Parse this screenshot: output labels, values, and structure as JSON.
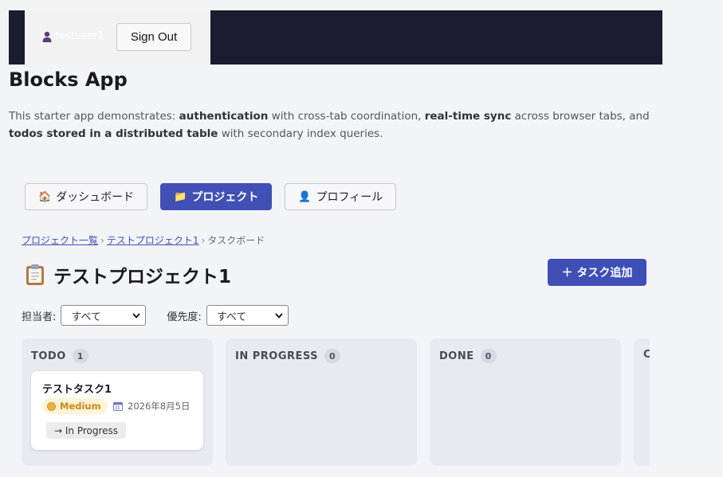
{
  "header": {
    "username": "testuser1",
    "sign_out_label": "Sign Out"
  },
  "app": {
    "title": "Blocks App",
    "description": [
      {
        "text": "This starter app demonstrates: ",
        "bold": false
      },
      {
        "text": "authentication",
        "bold": true
      },
      {
        "text": " with cross-tab coordination, ",
        "bold": false
      },
      {
        "text": "real-time sync",
        "bold": true
      },
      {
        "text": " across browser tabs, and ",
        "bold": false
      },
      {
        "text": "todos stored in a distributed table",
        "bold": true
      },
      {
        "text": " with secondary index queries.",
        "bold": false
      }
    ]
  },
  "nav": {
    "items": [
      {
        "label": "ダッシュボード",
        "icon": "house-icon",
        "glyph": "🏠",
        "active": false
      },
      {
        "label": "プロジェクト",
        "icon": "folder-icon",
        "glyph": "📁",
        "active": true
      },
      {
        "label": "プロフィール",
        "icon": "user-icon",
        "glyph": "👤",
        "active": false
      }
    ]
  },
  "breadcrumb": {
    "items": [
      "プロジェクト一覧",
      "テストプロジェクト1",
      "タスクボード"
    ],
    "separator": "›"
  },
  "project": {
    "title": "テストプロジェクト1",
    "add_task_label": "＋ タスク追加"
  },
  "filters": {
    "assignee_label": "担当者:",
    "assignee_value": "すべて",
    "priority_label": "優先度:",
    "priority_value": "すべて"
  },
  "board": {
    "columns": [
      {
        "title": "TODO",
        "count": "1"
      },
      {
        "title": "IN PROGRESS",
        "count": "0"
      },
      {
        "title": "DONE",
        "count": "0"
      },
      {
        "title": "C",
        "count": ""
      }
    ],
    "cards": [
      {
        "title": "テストタスク1",
        "priority": "Medium",
        "due": "2026年8月5日",
        "move_label": "→ In Progress"
      }
    ]
  },
  "colors": {
    "topbar": "#1b1c2f",
    "accent": "#4150b5",
    "priority_medium": "#c6891a"
  }
}
